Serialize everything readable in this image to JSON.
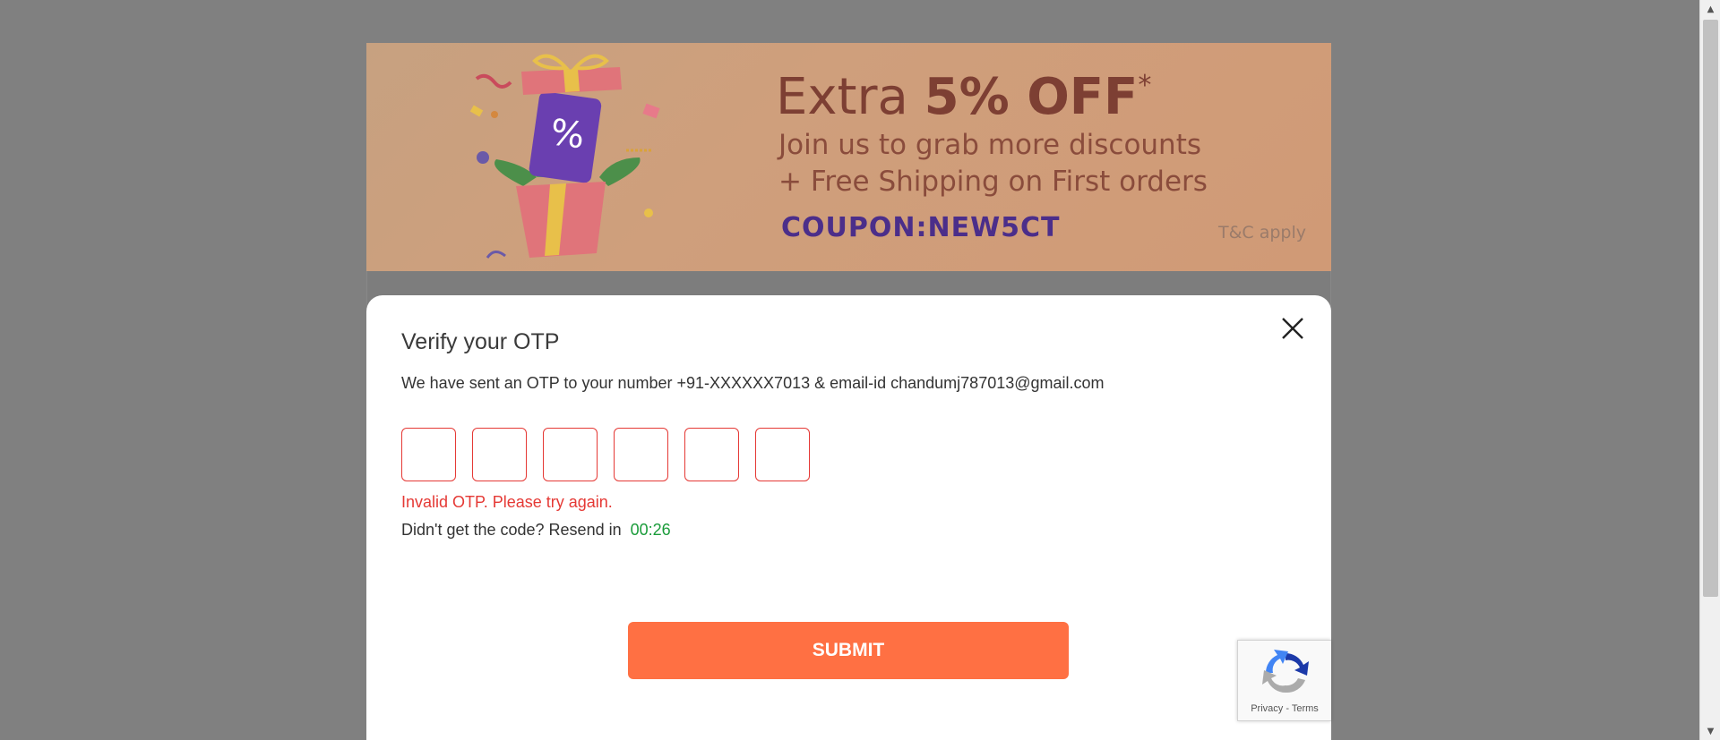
{
  "banner": {
    "headline_prefix": "Extra ",
    "headline_bold": "5% OFF",
    "headline_star": "*",
    "line1": "Join us to grab more discounts",
    "line2": "+ Free Shipping on First orders",
    "coupon": "COUPON:NEW5CT",
    "tc": "T&C apply"
  },
  "modal": {
    "title": "Verify your OTP",
    "description": "We have sent an OTP to your number +91-XXXXXX7013 & email-id chandumj787013@gmail.com",
    "otp_digits": [
      "",
      "",
      "",
      "",
      "",
      ""
    ],
    "error": "Invalid OTP. Please try again.",
    "resend_text": "Didn't get the code? Resend in",
    "resend_timer": "00:26",
    "submit_label": "SUBMIT"
  },
  "recaptcha": {
    "privacy": "Privacy",
    "separator": "-",
    "terms": "Terms"
  },
  "colors": {
    "overlay": "#808080",
    "error": "#e53935",
    "timer": "#1a9c3a",
    "submit": "#ff7043"
  }
}
